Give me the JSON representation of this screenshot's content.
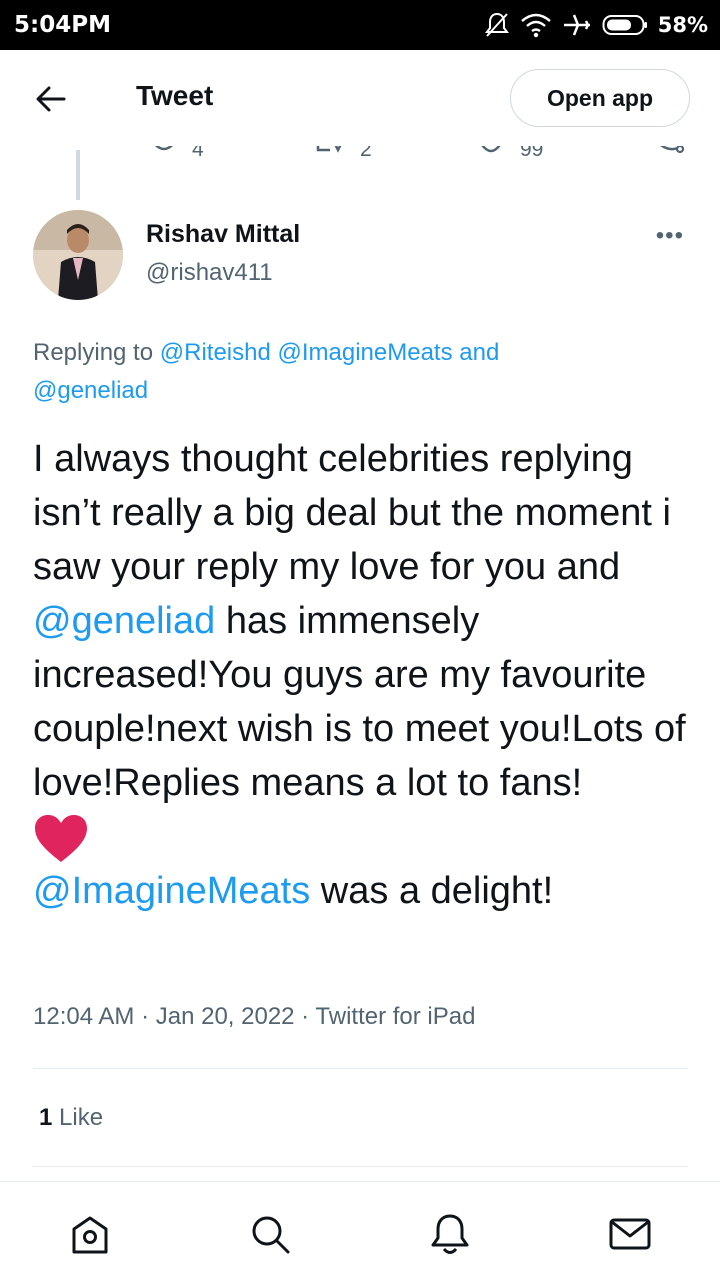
{
  "status_bar": {
    "time": "5:04PM",
    "battery": "58%"
  },
  "header": {
    "title": "Tweet",
    "open_app": "Open app"
  },
  "prev_tweet": {
    "replies": "4",
    "retweets": "2",
    "likes": "99"
  },
  "tweet": {
    "author_name": "Rishav Mittal",
    "author_handle": "@rishav411",
    "replying_prefix": "Replying to ",
    "replying_mention_1": "@Riteishd",
    "replying_mention_2": "@ImagineMeats",
    "replying_and": " and",
    "replying_mention_3": "@geneliad",
    "text_part_1": "I always thought celebrities replying isn’t really a big deal but the moment i saw your reply my love for you and ",
    "text_mention_1": "@geneliad",
    "text_part_2": " has immensely increased!You guys are my favourite couple!next wish is to meet you!Lots of love!Replies means a lot to fans!",
    "text_mention_2": "@ImagineMeats",
    "text_part_3": " was a delight!",
    "meta": "12:04 AM · Jan 20, 2022 · Twitter for iPad",
    "like_count": "1",
    "like_label": " Like"
  },
  "colors": {
    "link": "#1d9bf0",
    "heart": "#e0245e",
    "secondary_text": "#536471"
  },
  "nav": {
    "items": [
      "home-icon",
      "search-icon",
      "notifications-icon",
      "messages-icon"
    ]
  }
}
